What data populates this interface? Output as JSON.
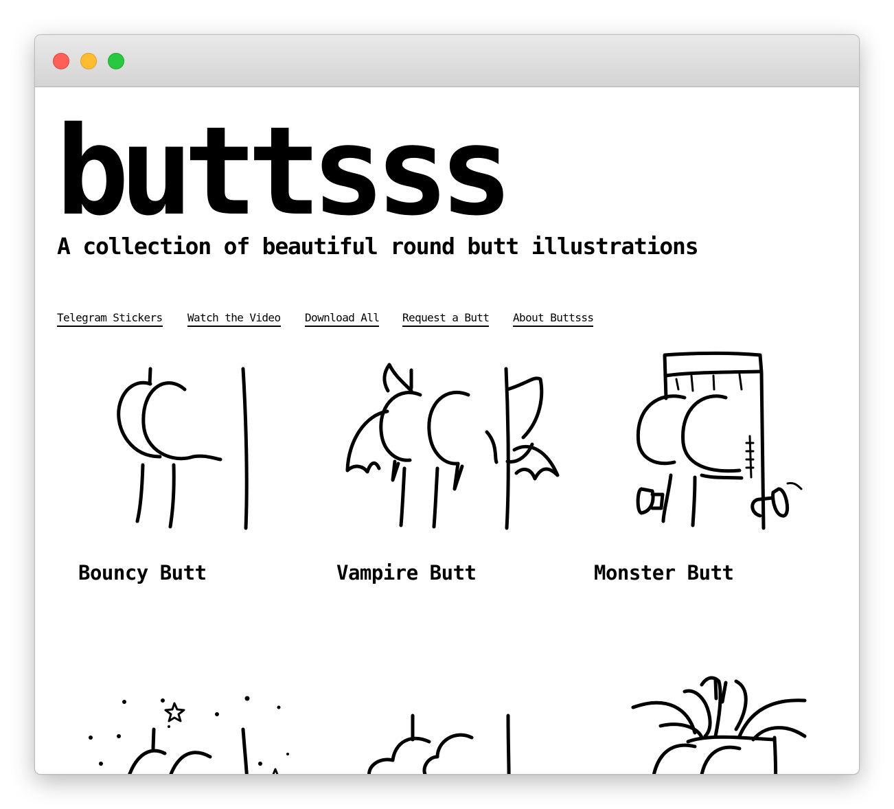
{
  "window": {
    "controls": [
      {
        "name": "close",
        "color": "#fe5f57"
      },
      {
        "name": "minimize",
        "color": "#febc2e"
      },
      {
        "name": "maximize",
        "color": "#28c840"
      }
    ]
  },
  "site": {
    "title": "buttsss",
    "tagline": "A collection of beautiful round butt illustrations"
  },
  "nav": {
    "links": [
      {
        "label": "Telegram Stickers"
      },
      {
        "label": "Watch the Video"
      },
      {
        "label": "Download All"
      },
      {
        "label": "Request a Butt"
      },
      {
        "label": "About Buttsss"
      }
    ]
  },
  "gallery": {
    "items": [
      {
        "title": "Bouncy Butt",
        "icon": "bouncy-butt-illustration"
      },
      {
        "title": "Vampire Butt",
        "icon": "vampire-butt-illustration"
      },
      {
        "title": "Monster Butt",
        "icon": "monster-butt-illustration"
      },
      {
        "title": "",
        "icon": "starry-butt-illustration"
      },
      {
        "title": "",
        "icon": "cloud-butt-illustration"
      },
      {
        "title": "",
        "icon": "plant-pot-butt-illustration"
      }
    ]
  }
}
